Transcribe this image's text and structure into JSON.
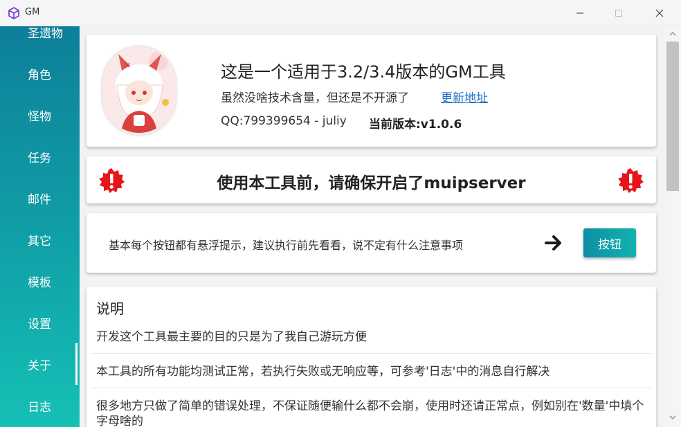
{
  "window": {
    "title": "GM",
    "icon": "cube-icon",
    "controls": [
      "minimize-icon",
      "maximize-icon",
      "close-icon"
    ]
  },
  "sidebar": {
    "items": [
      {
        "label": "圣遗物"
      },
      {
        "label": "角色"
      },
      {
        "label": "怪物"
      },
      {
        "label": "任务"
      },
      {
        "label": "邮件"
      },
      {
        "label": "其它"
      },
      {
        "label": "模板"
      },
      {
        "label": "设置"
      },
      {
        "label": "关于"
      },
      {
        "label": "日志"
      }
    ],
    "selected": "关于",
    "gradient": [
      "#0e7f99",
      "#15c0b5"
    ]
  },
  "about": {
    "title": "这是一个适用于3.2/3.4版本的GM工具",
    "subtitle": "虽然没啥技术含量，但还是不开源了",
    "update_link": "更新地址",
    "qq": "QQ:799399654 - juliy",
    "version": "当前版本:v1.0.6",
    "avatar": "anime-avatar-image"
  },
  "warning": {
    "text": "使用本工具前，请确保开启了muipserver",
    "icon": "alert-badge-icon",
    "color": "#e8141c"
  },
  "tip": {
    "text": "基本每个按钮都有悬浮提示，建议执行前先看看，说不定有什么注意事项",
    "arrow_icon": "arrow-right-icon",
    "button_label": "按钮",
    "button_color": "#109fa8"
  },
  "description": {
    "title": "说明",
    "items": [
      "开发这个工具最主要的目的只是为了我自己游玩方便",
      "本工具的所有功能均测试正常，若执行失败或无响应等，可参考'日志'中的消息自行解决",
      "很多地方只做了简单的错误处理，不保证随便输什么都不会崩，使用时还请正常点，例如别在'数量'中填个字母啥的"
    ]
  }
}
